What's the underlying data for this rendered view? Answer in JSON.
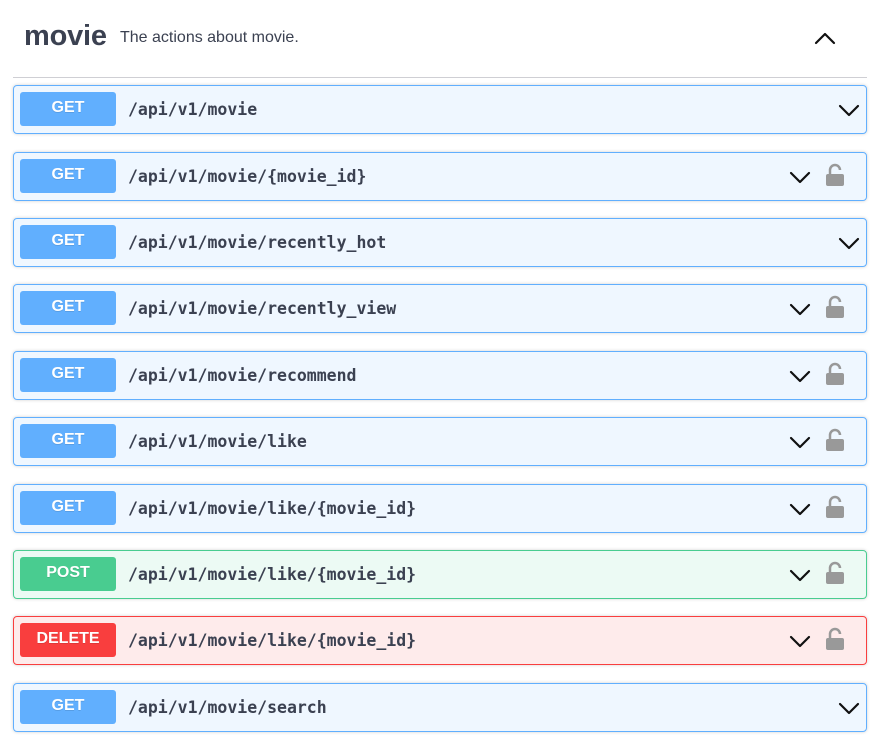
{
  "tag": {
    "name": "movie",
    "description": "The actions about movie."
  },
  "operations": [
    {
      "method": "GET",
      "path": "/api/v1/movie",
      "locked": false
    },
    {
      "method": "GET",
      "path": "/api/v1/movie/{movie_id}",
      "locked": true
    },
    {
      "method": "GET",
      "path": "/api/v1/movie/recently_hot",
      "locked": false
    },
    {
      "method": "GET",
      "path": "/api/v1/movie/recently_view",
      "locked": true
    },
    {
      "method": "GET",
      "path": "/api/v1/movie/recommend",
      "locked": true
    },
    {
      "method": "GET",
      "path": "/api/v1/movie/like",
      "locked": true
    },
    {
      "method": "GET",
      "path": "/api/v1/movie/like/{movie_id}",
      "locked": true
    },
    {
      "method": "POST",
      "path": "/api/v1/movie/like/{movie_id}",
      "locked": true
    },
    {
      "method": "DELETE",
      "path": "/api/v1/movie/like/{movie_id}",
      "locked": true
    },
    {
      "method": "GET",
      "path": "/api/v1/movie/search",
      "locked": false
    }
  ],
  "colors": {
    "get": "#61affe",
    "post": "#49cc90",
    "delete": "#f93e3e",
    "text": "#3b4151",
    "lock": "#999999"
  },
  "icons": {
    "collapse": "chevron-up-icon",
    "expand": "chevron-down-icon",
    "auth": "lock-icon"
  }
}
